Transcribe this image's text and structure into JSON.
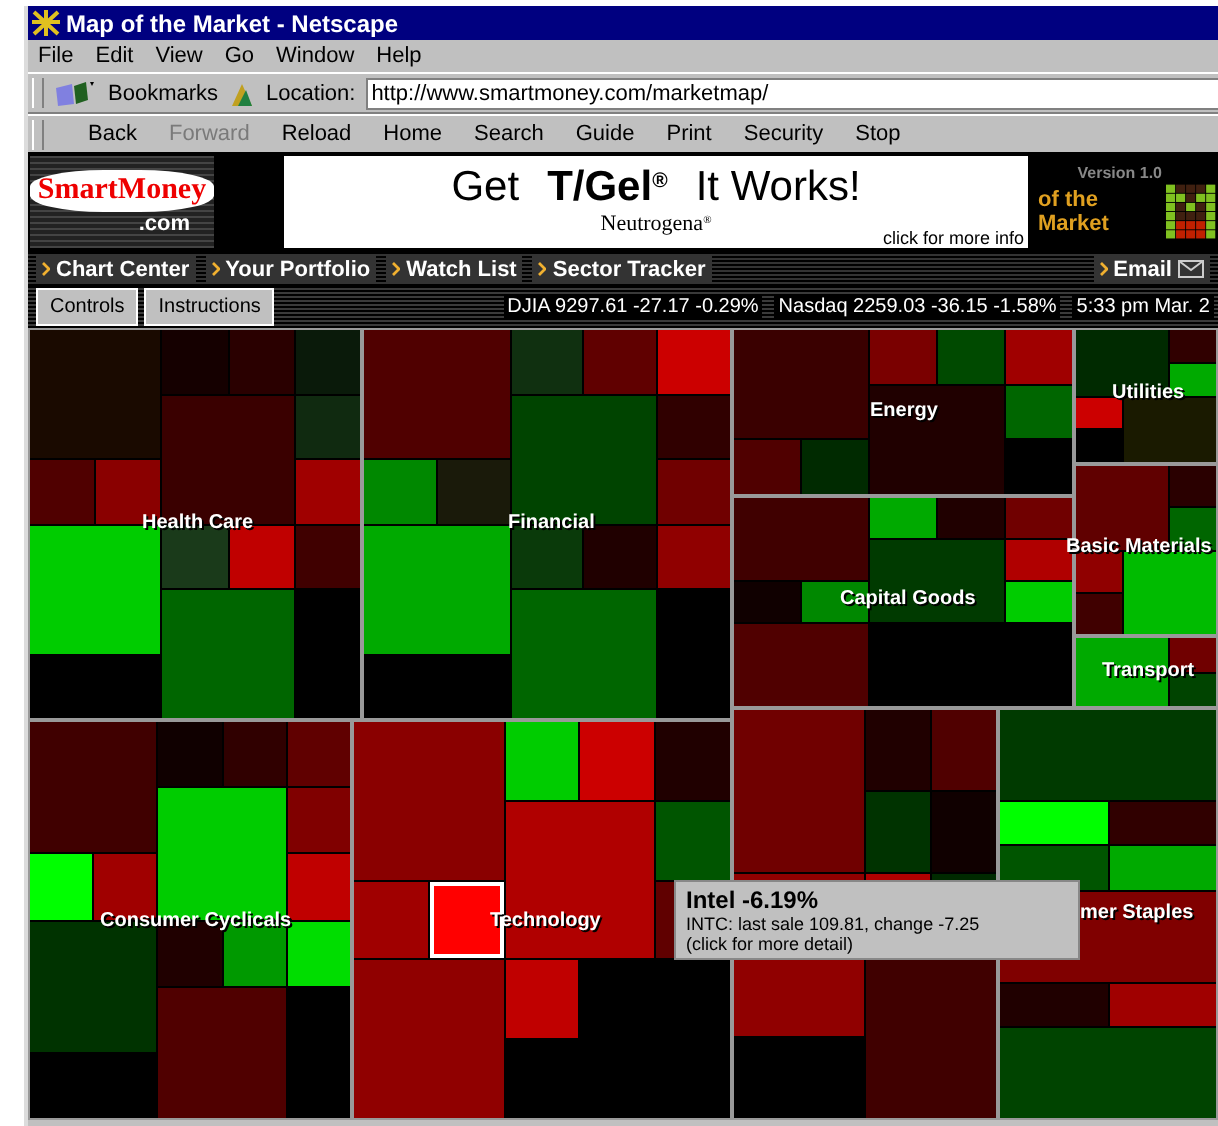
{
  "window": {
    "title": "Map of the Market - Netscape"
  },
  "menu": [
    "File",
    "Edit",
    "View",
    "Go",
    "Window",
    "Help"
  ],
  "location_bar": {
    "bookmarks": "Bookmarks",
    "label": "Location:",
    "url": "http://www.smartmoney.com/marketmap/"
  },
  "toolbar": [
    {
      "label": "Back",
      "disabled": false
    },
    {
      "label": "Forward",
      "disabled": true
    },
    {
      "label": "Reload",
      "disabled": false
    },
    {
      "label": "Home",
      "disabled": false
    },
    {
      "label": "Search",
      "disabled": false
    },
    {
      "label": "Guide",
      "disabled": false
    },
    {
      "label": "Print",
      "disabled": false
    },
    {
      "label": "Security",
      "disabled": false
    },
    {
      "label": "Stop",
      "disabled": false
    }
  ],
  "banner": {
    "logo": "SmartMoney",
    "logo_suffix": ".com",
    "ad": {
      "get": "Get",
      "brand": "T/Gel",
      "mark": "®",
      "slogan": "It Works!",
      "maker": "Neutrogena",
      "maker_mark": "®",
      "cta": "click for more info"
    },
    "version": "Version 1.0",
    "product": "of the Market"
  },
  "nav": [
    {
      "label": "Chart Center"
    },
    {
      "label": "Your Portfolio"
    },
    {
      "label": "Watch List"
    },
    {
      "label": "Sector Tracker"
    }
  ],
  "email": "Email",
  "controls": [
    "Controls",
    "Instructions"
  ],
  "ticker": [
    "DJIA 9297.61 -27.17 -0.29%",
    "Nasdaq 2259.03 -36.15 -1.58%",
    "5:33 pm  Mar. 2"
  ],
  "sectors": [
    {
      "label": "Health Care",
      "cells": [
        {
          "color": "#1a0a00",
          "selected": false
        },
        {
          "color": "#150000",
          "selected": false
        },
        {
          "color": "#2a0000",
          "selected": false
        },
        {
          "color": "#0a1a0a",
          "selected": false
        },
        {
          "color": "#3a0000",
          "selected": false
        },
        {
          "color": "#102a10",
          "selected": false
        },
        {
          "color": "#500000",
          "selected": false
        },
        {
          "color": "#8a0000",
          "selected": false
        },
        {
          "color": "#00cc00",
          "selected": false
        },
        {
          "color": "#a00000",
          "selected": false
        },
        {
          "color": "#1a3a1a",
          "selected": false
        },
        {
          "color": "#c00000",
          "selected": false
        },
        {
          "color": "#006600",
          "selected": false
        },
        {
          "color": "#400000",
          "selected": false
        }
      ]
    },
    {
      "label": "Financial",
      "cells": [
        {
          "color": "#500000",
          "selected": false
        },
        {
          "color": "#103010",
          "selected": false
        },
        {
          "color": "#600000",
          "selected": false
        },
        {
          "color": "#cc0000",
          "selected": false
        },
        {
          "color": "#004400",
          "selected": false
        },
        {
          "color": "#300000",
          "selected": false
        },
        {
          "color": "#008800",
          "selected": false
        },
        {
          "color": "#1a1a0a",
          "selected": false
        },
        {
          "color": "#00aa00",
          "selected": false
        },
        {
          "color": "#700000",
          "selected": false
        },
        {
          "color": "#0a3a0a",
          "selected": false
        },
        {
          "color": "#200000",
          "selected": false
        },
        {
          "color": "#006600",
          "selected": false
        },
        {
          "color": "#900000",
          "selected": false
        }
      ]
    },
    {
      "label": "Energy",
      "cells": [
        {
          "color": "#3a0000",
          "selected": false
        },
        {
          "color": "#7a0000",
          "selected": false
        },
        {
          "color": "#004a00",
          "selected": false
        },
        {
          "color": "#a00000",
          "selected": false
        },
        {
          "color": "#200000",
          "selected": false
        },
        {
          "color": "#006600",
          "selected": false
        },
        {
          "color": "#500000",
          "selected": false
        },
        {
          "color": "#002a00",
          "selected": false
        }
      ]
    },
    {
      "label": "Utilities",
      "cells": [
        {
          "color": "#002a00",
          "selected": false
        },
        {
          "color": "#300000",
          "selected": false
        },
        {
          "color": "#00aa00",
          "selected": false
        },
        {
          "color": "#cc0000",
          "selected": false
        },
        {
          "color": "#1a1a00",
          "selected": false
        }
      ]
    },
    {
      "label": "Capital Goods",
      "cells": [
        {
          "color": "#400000",
          "selected": false
        },
        {
          "color": "#00aa00",
          "selected": false
        },
        {
          "color": "#200000",
          "selected": false
        },
        {
          "color": "#700000",
          "selected": false
        },
        {
          "color": "#003a00",
          "selected": false
        },
        {
          "color": "#b00000",
          "selected": false
        },
        {
          "color": "#100000",
          "selected": false
        },
        {
          "color": "#008800",
          "selected": false
        },
        {
          "color": "#500000",
          "selected": false
        },
        {
          "color": "#00cc00",
          "selected": false
        }
      ]
    },
    {
      "label": "Basic Materials",
      "cells": [
        {
          "color": "#600000",
          "selected": false
        },
        {
          "color": "#2a0000",
          "selected": false
        },
        {
          "color": "#006600",
          "selected": false
        },
        {
          "color": "#900000",
          "selected": false
        },
        {
          "color": "#00bb00",
          "selected": false
        },
        {
          "color": "#400000",
          "selected": false
        }
      ]
    },
    {
      "label": "Transport",
      "cells": [
        {
          "color": "#00aa00",
          "selected": false
        },
        {
          "color": "#700000",
          "selected": false
        },
        {
          "color": "#004400",
          "selected": false
        }
      ]
    },
    {
      "label": "Consumer Cyclicals",
      "cells": [
        {
          "color": "#400000",
          "selected": false
        },
        {
          "color": "#100000",
          "selected": false
        },
        {
          "color": "#300000",
          "selected": false
        },
        {
          "color": "#600000",
          "selected": false
        },
        {
          "color": "#00cc00",
          "selected": false
        },
        {
          "color": "#800000",
          "selected": false
        },
        {
          "color": "#00ff00",
          "selected": false
        },
        {
          "color": "#a00000",
          "selected": false
        },
        {
          "color": "#003300",
          "selected": false
        },
        {
          "color": "#c00000",
          "selected": false
        },
        {
          "color": "#200000",
          "selected": false
        },
        {
          "color": "#009900",
          "selected": false
        },
        {
          "color": "#500000",
          "selected": false
        },
        {
          "color": "#00dd00",
          "selected": false
        }
      ]
    },
    {
      "label": "Technology",
      "cells": [
        {
          "color": "#8a0000",
          "selected": false
        },
        {
          "color": "#00cc00",
          "selected": false
        },
        {
          "color": "#cc0000",
          "selected": false
        },
        {
          "color": "#200000",
          "selected": false
        },
        {
          "color": "#b00000",
          "selected": false
        },
        {
          "color": "#005500",
          "selected": false
        },
        {
          "color": "#a00000",
          "selected": false
        },
        {
          "color": "#ff0000",
          "selected": true
        },
        {
          "color": "#900000",
          "selected": false
        },
        {
          "color": "#600000",
          "selected": false
        },
        {
          "color": "#c00000",
          "selected": false
        }
      ]
    },
    {
      "cells": [
        {
          "color": "#700000",
          "selected": false
        },
        {
          "color": "#200000",
          "selected": false
        },
        {
          "color": "#500000",
          "selected": false
        },
        {
          "color": "#003300",
          "selected": false
        },
        {
          "color": "#900000",
          "selected": false
        },
        {
          "color": "#100000",
          "selected": false
        },
        {
          "color": "#b00000",
          "selected": false
        },
        {
          "color": "#002a00",
          "selected": false
        },
        {
          "color": "#400000",
          "selected": false
        }
      ]
    },
    {
      "label": "mer Staples",
      "cells": [
        {
          "color": "#003a00",
          "selected": false
        },
        {
          "color": "#00ff00",
          "selected": false
        },
        {
          "color": "#300000",
          "selected": false
        },
        {
          "color": "#005500",
          "selected": false
        },
        {
          "color": "#800000",
          "selected": false
        },
        {
          "color": "#00aa00",
          "selected": false
        },
        {
          "color": "#200000",
          "selected": false
        },
        {
          "color": "#a00000",
          "selected": false
        },
        {
          "color": "#004400",
          "selected": false
        }
      ]
    }
  ],
  "tooltip": {
    "title": "Intel -6.19%",
    "detail": "INTC: last sale 109.81,  change -7.25",
    "hint": "(click for more detail)"
  }
}
